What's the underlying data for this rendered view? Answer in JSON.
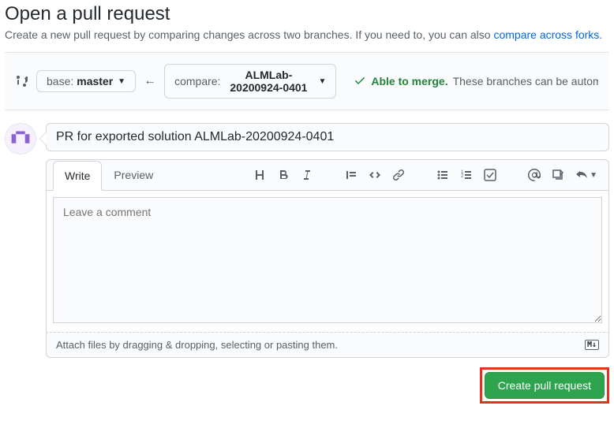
{
  "page": {
    "title": "Open a pull request",
    "subtitle_prefix": "Create a new pull request by comparing changes across two branches. If you need to, you can also ",
    "subtitle_link": "compare across forks",
    "subtitle_suffix": "."
  },
  "branches": {
    "base_label": "base:",
    "base_value": "master",
    "compare_label": "compare:",
    "compare_value": "ALMLab-20200924-0401"
  },
  "merge": {
    "able_label": "Able to merge.",
    "detail": "These branches can be automatically me"
  },
  "pr": {
    "title_value": "PR for exported solution ALMLab-20200924-0401",
    "comment_placeholder": "Leave a comment",
    "attach_hint": "Attach files by dragging & dropping, selecting or pasting them.",
    "md_badge": "M↓"
  },
  "tabs": {
    "write": "Write",
    "preview": "Preview"
  },
  "actions": {
    "create": "Create pull request"
  }
}
